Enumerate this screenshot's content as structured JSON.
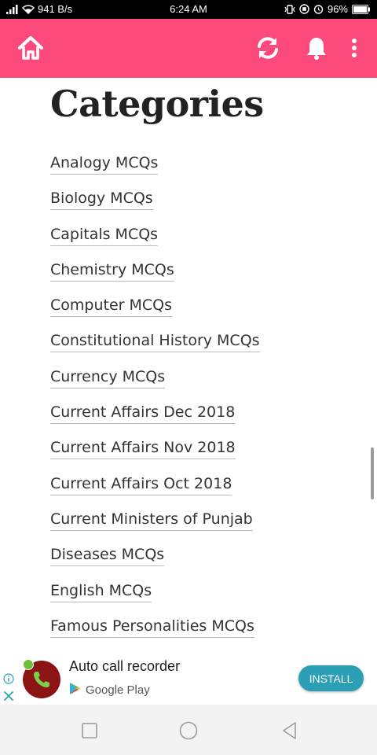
{
  "status_bar": {
    "network_speed": "941 B/s",
    "time": "6:24 AM",
    "battery": "96%"
  },
  "app_bar": {
    "home_icon": "home-icon",
    "refresh_icon": "refresh-icon",
    "bell_icon": "bell-icon",
    "more_icon": "more-vert-icon",
    "color": "#fd4a7c"
  },
  "page": {
    "title": "Categories",
    "categories": [
      "Analogy MCQs",
      "Biology MCQs",
      "Capitals MCQs",
      "Chemistry MCQs",
      "Computer MCQs",
      "Constitutional History MCQs",
      "Currency MCQs",
      "Current Affairs Dec 2018",
      "Current Affairs Nov 2018",
      "Current Affairs Oct 2018",
      "Current Ministers of Punjab",
      "Diseases MCQs",
      "English MCQs",
      "Famous Personalities MCQs"
    ]
  },
  "ad": {
    "title": "Auto call recorder",
    "store": "Google Play",
    "install_label": "INSTALL",
    "install_color": "#2a9fb6"
  }
}
